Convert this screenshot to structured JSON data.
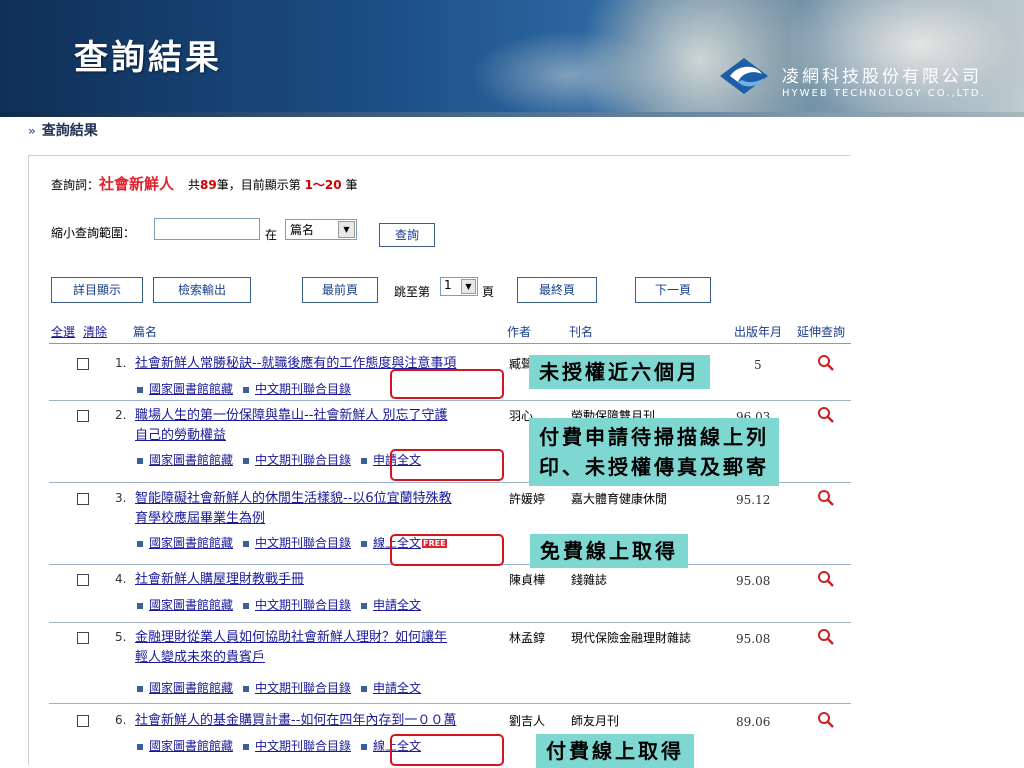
{
  "banner": {
    "title": "查詢結果",
    "company_cn": "凌網科技股份有限公司",
    "company_en": "HYWEB TECHNOLOGY CO.,LTD."
  },
  "section": {
    "heading": "查詢結果"
  },
  "query": {
    "label": "查詢詞：",
    "term": "社會新鮮人",
    "total_prefix": "共",
    "total": "89",
    "total_mid": "筆，目前顯示第 ",
    "range": "1～20",
    "total_suffix": " 筆"
  },
  "narrow": {
    "label": "縮小查詢範圍：",
    "input_value": "",
    "in_label": "在",
    "field_selected": "篇名",
    "query_button": "查詢"
  },
  "toolbar": {
    "detail": "詳目顯示",
    "export": "檢索輸出",
    "first": "最前頁",
    "jump_prefix": "跳至第",
    "page_selected": "1",
    "jump_suffix": "頁",
    "last": "最終頁",
    "next": "下一頁"
  },
  "columns": {
    "select_all": "全選",
    "clear": "清除",
    "title": "篇名",
    "author": "作者",
    "journal": "刊名",
    "date": "出版年月",
    "ext": "延伸查詢"
  },
  "results": [
    {
      "num": "1.",
      "title1": "社會新鮮人常勝秘訣--就職後應有的工作態度與注意事項",
      "title2": "",
      "author": "臧聲",
      "journal": "",
      "date": "5",
      "links": [
        "國家圖書館館藏",
        "中文期刊聯合目錄"
      ]
    },
    {
      "num": "2.",
      "title1": "職場人生的第一份保障與靠山--社會新鮮人 別忘了守護",
      "title2": "自己的勞動權益",
      "author": "羽心",
      "journal": "勞動保障雙月刊",
      "date": "96.03",
      "links": [
        "國家圖書館館藏",
        "中文期刊聯合目錄",
        "申請全文"
      ]
    },
    {
      "num": "3.",
      "title1": "智能障礙社會新鮮人的休閒生活樣貌--以6位宜蘭特殊教",
      "title2": "育學校應屆畢業生為例",
      "author": "許媛婷",
      "journal": "嘉大體育健康休閒",
      "date": "95.12",
      "links": [
        "國家圖書館館藏",
        "中文期刊聯合目錄",
        "線上全文"
      ],
      "free": "FREE"
    },
    {
      "num": "4.",
      "title1": "社會新鮮人購屋理財教戰手冊",
      "title2": "",
      "author": "陳貞樺",
      "journal": "錢雜誌",
      "date": "95.08",
      "links": [
        "國家圖書館館藏",
        "中文期刊聯合目錄",
        "申請全文"
      ]
    },
    {
      "num": "5.",
      "title1": "金融理財從業人員如何協助社會新鮮人理財？如何讓年",
      "title2": "輕人變成未來的貴賓戶",
      "author": "林孟錞",
      "journal": "現代保險金融理財雜誌",
      "date": "95.08",
      "links": [
        "國家圖書館館藏",
        "中文期刊聯合目錄",
        "申請全文"
      ]
    },
    {
      "num": "6.",
      "title1": "社會新鮮人的基金購買計畫--如何在四年內存到一００萬",
      "title2": "",
      "author": "劉吉人",
      "journal": "師友月刊",
      "date": "89.06",
      "links": [
        "國家圖書館館藏",
        "中文期刊聯合目錄",
        "線上全文"
      ]
    }
  ],
  "callouts": {
    "c1": "未授權近六個月",
    "c2a": "付費申請待掃描線上列",
    "c2b": "印、未授權傳真及郵寄",
    "c3": "免費線上取得",
    "c4": "付費線上取得"
  },
  "colors": {
    "accent": "#e0222f",
    "callout_bg": "#7fd7d2",
    "annotation": "#d4151f",
    "link": "#1a1a99"
  }
}
